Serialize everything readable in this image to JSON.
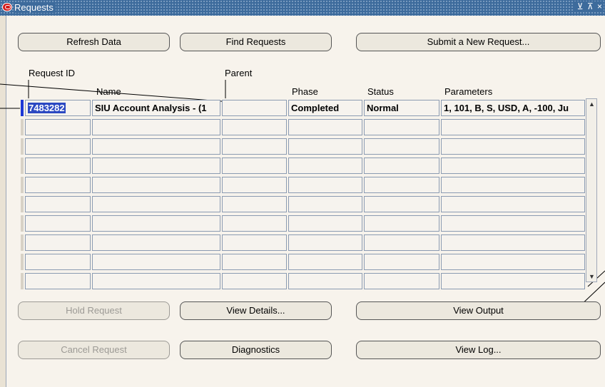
{
  "window": {
    "title": "Requests",
    "controls": [
      "⊻",
      "⊼",
      "×"
    ]
  },
  "toolbar": {
    "refresh_label": "Refresh Data",
    "find_label": "Find Requests",
    "submit_label": "Submit a New Request..."
  },
  "columns": {
    "request_id": "Request ID",
    "name": "Name",
    "parent": "Parent",
    "phase": "Phase",
    "status": "Status",
    "parameters": "Parameters"
  },
  "rows": [
    {
      "request_id": "7483282",
      "name": "SIU Account Analysis - (1",
      "parent": "",
      "phase": "Completed",
      "status": "Normal",
      "parameters": "1, 101, B, S, USD, A, -100, Ju"
    }
  ],
  "actions": {
    "hold_label": "Hold Request",
    "view_details_label": "View Details...",
    "view_output_label": "View Output",
    "cancel_label": "Cancel Request",
    "diagnostics_label": "Diagnostics",
    "view_log_label": "View Log..."
  }
}
